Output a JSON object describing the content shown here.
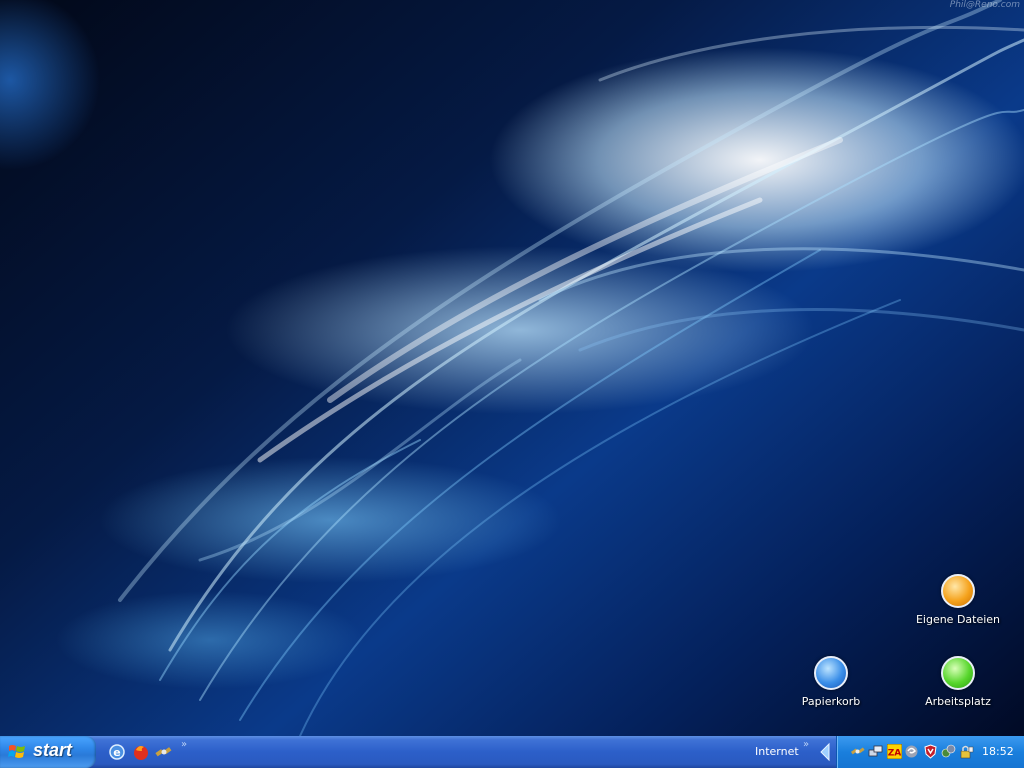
{
  "desktop": {
    "watermark": "Phil@Reno.com",
    "icons": [
      {
        "label": "Eigene Dateien",
        "icon": "my-documents-icon",
        "color": "#f5a21c"
      },
      {
        "label": "Papierkorb",
        "icon": "recycle-bin-icon",
        "color": "#3a8ee8"
      },
      {
        "label": "Arbeitsplatz",
        "icon": "my-computer-icon",
        "color": "#57d62c"
      }
    ]
  },
  "taskbar": {
    "start_label": "start",
    "quick_launch": [
      "internet-explorer-icon",
      "firefox-icon",
      "satellite-icon"
    ],
    "address_label": "Internet",
    "tray_icons": [
      "satellite-tray-icon",
      "network-tray-icon",
      "zonealarm-icon",
      "swirl-tray-icon",
      "antivirus-shield-icon",
      "connection-tray-icon",
      "lock-tray-icon"
    ],
    "clock": "18:52"
  },
  "colors": {
    "taskbar_blue": "#2c5fc9",
    "start_button": "#2e86e8",
    "tray_blue": "#1a7fdd"
  }
}
